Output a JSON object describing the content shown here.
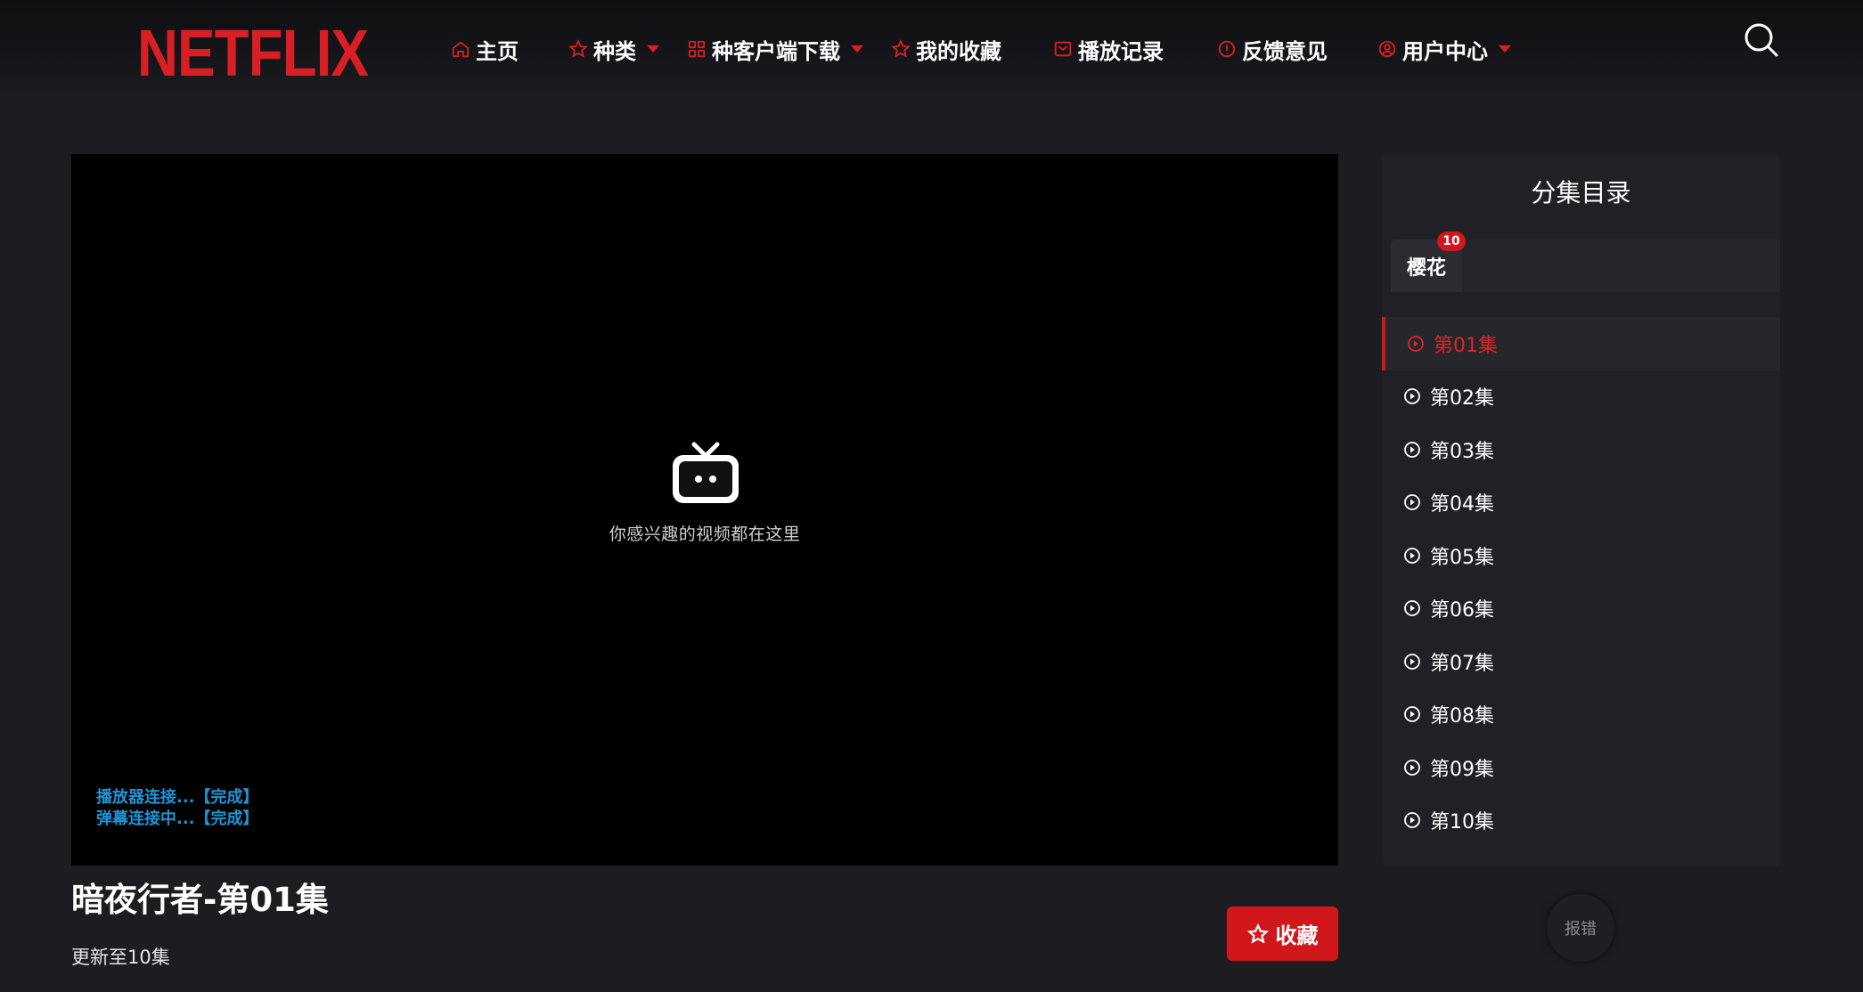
{
  "brand": {
    "logo_text": "NETFLIX",
    "accent_color": "#d81f26"
  },
  "nav": {
    "items": [
      {
        "label": "主页",
        "icon": "home-icon",
        "has_caret": false
      },
      {
        "label": "种类",
        "icon": "star-icon",
        "has_caret": true
      },
      {
        "label": "种客户端下载",
        "icon": "grid-icon",
        "has_caret": true
      },
      {
        "label": "我的收藏",
        "icon": "star-icon",
        "has_caret": false
      },
      {
        "label": "播放记录",
        "icon": "history-icon",
        "has_caret": false
      },
      {
        "label": "反馈意见",
        "icon": "info-icon",
        "has_caret": false
      },
      {
        "label": "用户中心",
        "icon": "user-icon",
        "has_caret": true
      }
    ],
    "search_icon": "search-icon"
  },
  "player": {
    "placeholder_icon": "tv-icon",
    "caption": "你感兴趣的视频都在这里",
    "log": [
      "播放器连接...【完成】",
      "弹幕连接中...【完成】"
    ]
  },
  "video": {
    "title": "暗夜行者-第01集",
    "update_status": "更新至10集",
    "favorite_label": "收藏"
  },
  "episodes_panel": {
    "title": "分集目录",
    "source": {
      "label": "樱花",
      "count": "10"
    },
    "active_index": 0,
    "episodes": [
      "第01集",
      "第02集",
      "第03集",
      "第04集",
      "第05集",
      "第06集",
      "第07集",
      "第08集",
      "第09集",
      "第10集"
    ]
  },
  "report_label": "报错"
}
